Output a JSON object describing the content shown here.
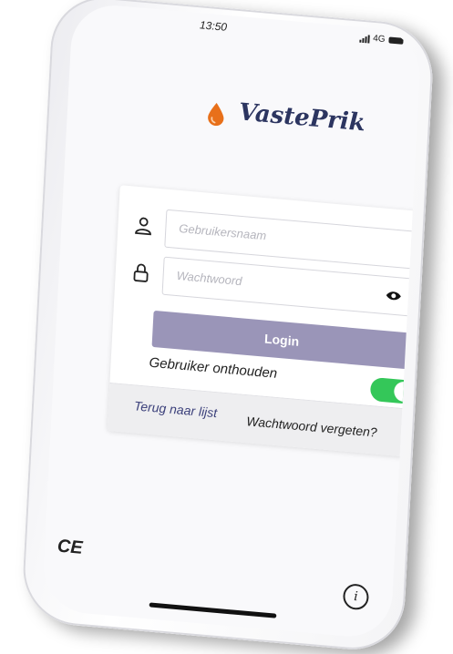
{
  "status_bar": {
    "time": "13:50",
    "network": "4G"
  },
  "brand": {
    "name": "VastePrik",
    "drop_color": "#e8701a"
  },
  "login_form": {
    "username_placeholder": "Gebruikersnaam",
    "password_placeholder": "Wachtwoord",
    "login_label": "Login",
    "remember_label": "Gebruiker onthouden",
    "remember_enabled": true
  },
  "footer_links": {
    "back": "Terug naar lijst",
    "forgot": "Wachtwoord vergeten?"
  },
  "badges": {
    "ce": "CE",
    "info": "i"
  },
  "colors": {
    "brand_text": "#2c3560",
    "button": "#9a95b8",
    "toggle_on": "#34c759",
    "link": "#3a3f7a"
  }
}
